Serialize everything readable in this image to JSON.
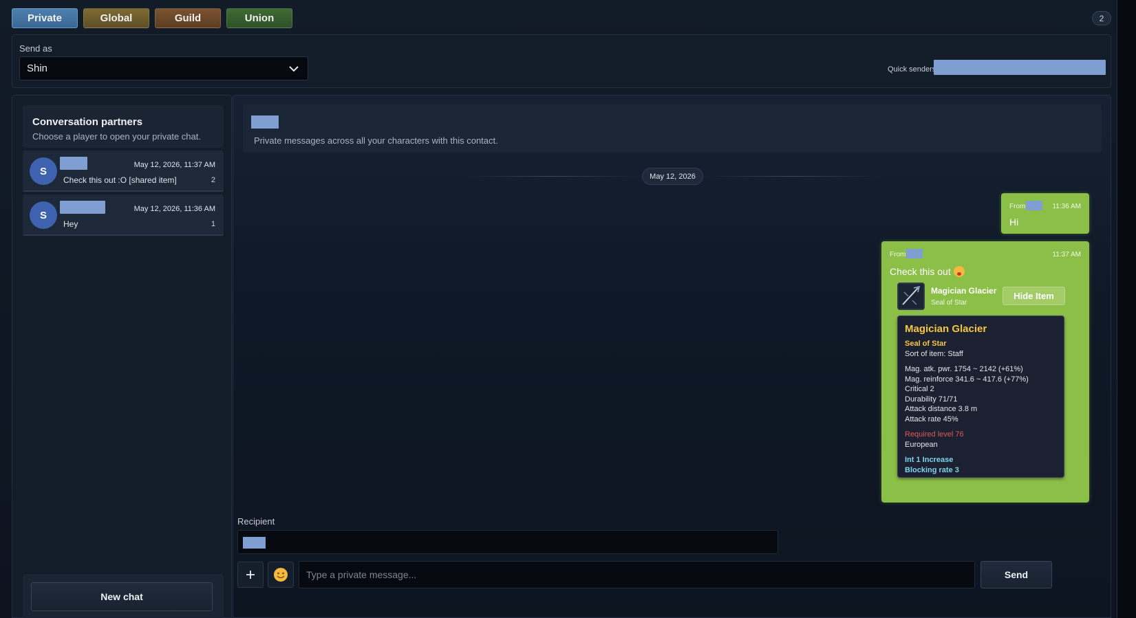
{
  "tabs": [
    {
      "label": "Private",
      "active": true
    },
    {
      "label": "Global"
    },
    {
      "label": "Guild"
    },
    {
      "label": "Union"
    }
  ],
  "unread_count": "2",
  "send_as": {
    "label": "Send as",
    "selected": "Shin"
  },
  "quick_senders": {
    "label": "Quick senders"
  },
  "sidebar": {
    "title": "Conversation partners",
    "subtitle": "Choose a player to open your private chat.",
    "contacts": [
      {
        "initial": "S",
        "time": "May 12, 2026, 11:37 AM",
        "preview": "Check this out :O [shared item]",
        "count": "2"
      },
      {
        "initial": "S",
        "time": "May 12, 2026, 11:36 AM",
        "preview": "Hey",
        "count": "1"
      }
    ],
    "new_chat_label": "New chat"
  },
  "chat": {
    "header_subtitle": "Private messages across all your characters with this contact.",
    "date_divider": "May 12, 2026",
    "messages": [
      {
        "from_label": "From",
        "time": "11:36 AM",
        "text": "Hi"
      },
      {
        "from_label": "From",
        "time": "11:37 AM",
        "text": "Check this out",
        "item": {
          "name": "Magician Glacier",
          "type": "Seal of Star",
          "hide_label": "Hide Item",
          "tooltip": {
            "title": "Magician Glacier",
            "rarity": "Seal of Star",
            "sort": "Sort of item: Staff",
            "stats": [
              "Mag. atk. pwr. 1754 ~ 2142 (+61%)",
              "Mag. reinforce 341.6 ~ 417.6 (+77%)",
              "Critical 2",
              "Durability 71/71",
              "Attack distance 3.8 m",
              "Attack rate 45%"
            ],
            "required_level": "Required level 76",
            "race": "European",
            "bonuses": [
              "Int 1 Increase",
              "Blocking rate 3"
            ]
          }
        }
      }
    ]
  },
  "composer": {
    "recipient_label": "Recipient",
    "add_icon": "plus-icon",
    "emoji_icon": "smiley-icon",
    "placeholder": "Type a private message...",
    "send_label": "Send"
  },
  "colors": {
    "tab_private": "#3f6e9a",
    "tab_global": "#6e5e2c",
    "tab_guild": "#6b4829",
    "tab_union": "#365e2d",
    "bubble_green": "#8cbf48",
    "item_gold": "#f5c841",
    "item_red": "#e05757",
    "item_cyan": "#7fd3ee",
    "redaction": "#7f9fd3"
  }
}
